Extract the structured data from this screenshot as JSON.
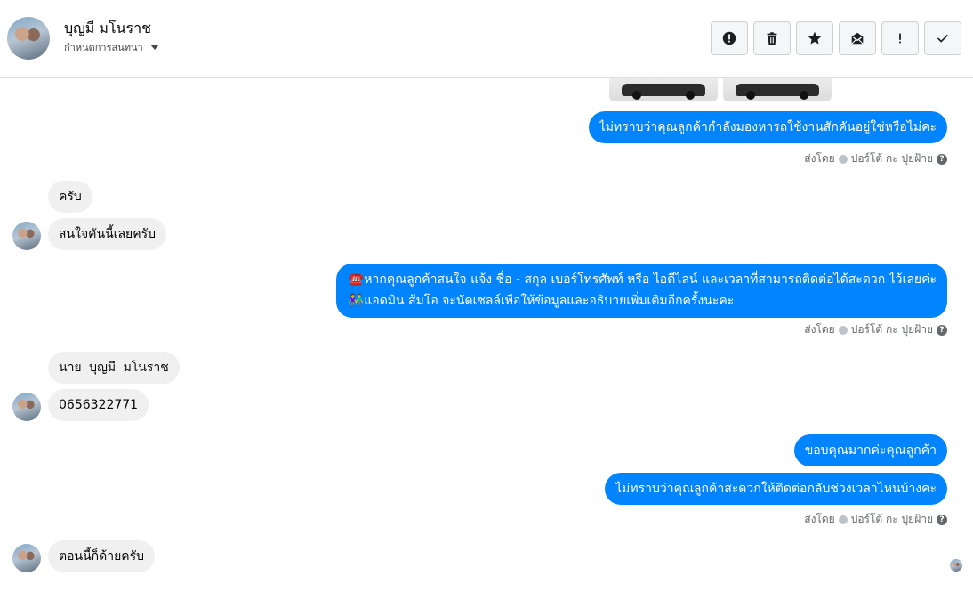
{
  "header": {
    "name": "บุญมี มโนราช",
    "subtitle": "กำหนดการสนทนา",
    "actions": [
      {
        "icon": "alert-circle-icon",
        "label": "report"
      },
      {
        "icon": "trash-icon",
        "label": "delete"
      },
      {
        "icon": "star-icon",
        "label": "star"
      },
      {
        "icon": "mail-icon",
        "label": "mark unread"
      },
      {
        "icon": "exclamation-icon",
        "label": "spam"
      },
      {
        "icon": "check-icon",
        "label": "done"
      }
    ]
  },
  "messages": {
    "m1": "ไม่ทราบว่าคุณลูกค้ากำลังมองหารถใช้งานสักคันอยู่ใช่หรือไม่คะ",
    "m2": "ครับ",
    "m3": "สนใจคันนี้เลยครับ",
    "m4_line1": "☎️หากคุณลูกค้าสนใจ แจ้ง ชื่อ - สกุล เบอร์โทรศัพท์ หรือ ไอดีไลน์ และเวลาที่สามารถติดต่อได้สะดวก ไว้เลยค่ะ",
    "m4_line2": "👫แอดมิน ส้มโอ จะนัดเซลล์เพื่อให้ข้อมูลและอธิบายเพิ่มเติมอีกครั้งนะคะ",
    "m5": "นาย บุญมี มโนราช",
    "m6": "0656322771",
    "m7": "ขอบคุณมากค่ะคุณลูกค้า",
    "m8": "ไม่ทราบว่าคุณลูกค้าสะดวกให้ติดต่อกลับช่วงเวลาไหนบ้างคะ",
    "m9": "ตอนนี้ก็ด้ายครับ"
  },
  "sent_by": {
    "prefix": "ส่งโดย",
    "agent": "ปอร์โต้ กะ ปุยฝ้าย"
  },
  "colors": {
    "outgoing": "#0084ff",
    "incoming": "#f0f0f0"
  }
}
